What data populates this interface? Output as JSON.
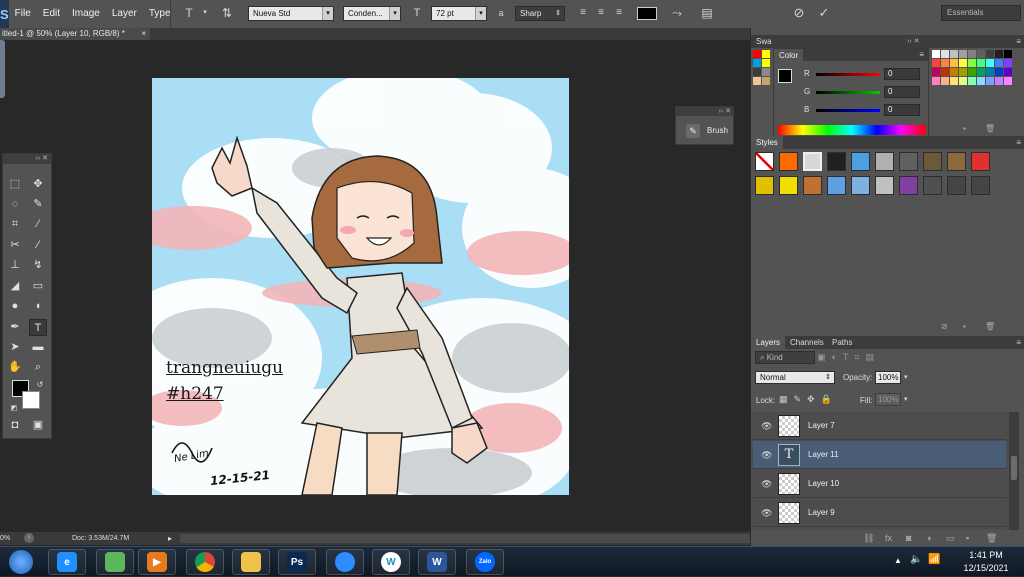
{
  "menu": {
    "logo": "S",
    "items": [
      "File",
      "Edit",
      "Image",
      "Layer",
      "Type"
    ]
  },
  "options": {
    "font_family": "Nueva Std",
    "font_style": "Conden...",
    "font_size": "72 pt",
    "aa_label": "a",
    "antialias": "Sharp",
    "workspace": "Essentials"
  },
  "doc_tab": {
    "title": "itled-1 @ 50% (Layer 10, RGB/8) *",
    "close": "×"
  },
  "canvas": {
    "signature_line1": "trangneuiugu",
    "signature_line2": "#h247",
    "handwriting_date": "12-15-21",
    "handwriting_name": "Ne Lim"
  },
  "brush_panel": {
    "label": "Brush"
  },
  "swatches_panel": {
    "tab_label": "Swa",
    "active_tab": "Color"
  },
  "color_panel": {
    "channels": [
      {
        "label": "R",
        "value": "0"
      },
      {
        "label": "G",
        "value": "0"
      },
      {
        "label": "B",
        "value": "0"
      }
    ]
  },
  "styles_panel": {
    "tab_label": "Styles"
  },
  "layers_panel": {
    "tabs": [
      "Layers",
      "Channels",
      "Paths"
    ],
    "kind_label": "Kind",
    "blend_mode": "Normal",
    "opacity_label": "Opacity:",
    "opacity_value": "100%",
    "lock_label": "Lock:",
    "fill_label": "Fill:",
    "fill_value": "100%",
    "layers": [
      {
        "name": "Layer 7",
        "thumb": ""
      },
      {
        "name": "Layer 11",
        "thumb": "T"
      },
      {
        "name": "Layer 10",
        "thumb": ""
      },
      {
        "name": "Layer 9",
        "thumb": ""
      }
    ],
    "selected_layer": "Layer 11"
  },
  "status": {
    "zoom": "0%",
    "doc_size": "Doc: 3.53M/24.7M"
  },
  "taskbar": {
    "time": "1:41 PM",
    "date": "12/15/2021",
    "apps": [
      {
        "name": "Start",
        "glyph": "",
        "color": "#3a7bd5"
      },
      {
        "name": "Internet Explorer",
        "glyph": "e",
        "color": "#1e90ff"
      },
      {
        "name": "Coc Coc",
        "glyph": "",
        "color": "#5cb85c"
      },
      {
        "name": "Media Player",
        "glyph": "▶",
        "color": "#e87a1e"
      },
      {
        "name": "Chrome",
        "glyph": "",
        "color": "#db4437"
      },
      {
        "name": "File Explorer",
        "glyph": "",
        "color": "#f0c14b"
      },
      {
        "name": "Photoshop",
        "glyph": "Ps",
        "color": "#0b2a4f"
      },
      {
        "name": "Zoom",
        "glyph": "",
        "color": "#2d8cff"
      },
      {
        "name": "Wizer",
        "glyph": "W",
        "color": "#ffffff"
      },
      {
        "name": "Word",
        "glyph": "W",
        "color": "#2b579a"
      },
      {
        "name": "Zalo",
        "glyph": "Zalo",
        "color": "#0068ff"
      }
    ]
  },
  "colors": {
    "panel_bg": "#535353",
    "app_bg": "#282828",
    "sky": "#a9def4",
    "selected_layer": "#4a5d76"
  }
}
